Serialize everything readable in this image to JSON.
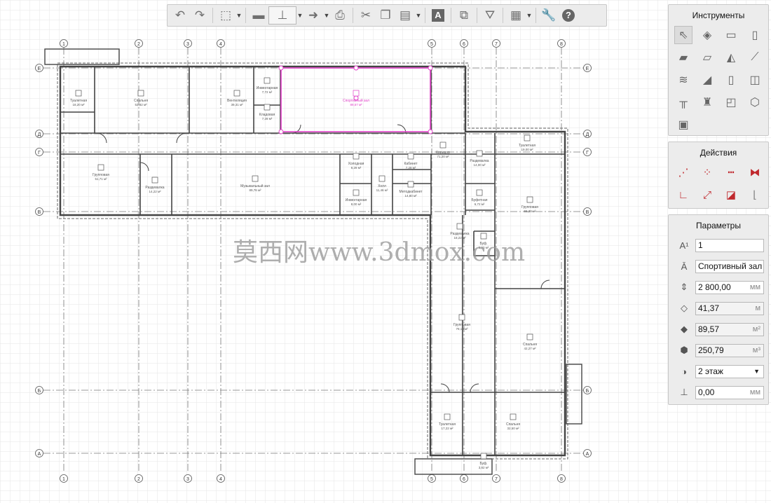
{
  "toolbar": {
    "buttons": [
      {
        "name": "undo-button",
        "icon": "undo-icon",
        "glyph": "↶"
      },
      {
        "name": "redo-button",
        "icon": "redo-icon",
        "glyph": "↷"
      },
      {
        "name": "view-3d-button",
        "icon": "cube-icon",
        "glyph": "⬚"
      },
      {
        "name": "open-button",
        "icon": "folder-icon",
        "glyph": "▬"
      },
      {
        "name": "import-button",
        "icon": "stamp-icon",
        "glyph": "⊥"
      },
      {
        "name": "export-button",
        "icon": "export-icon",
        "glyph": "➜"
      },
      {
        "name": "print-button",
        "icon": "printer-icon",
        "glyph": "⎙"
      },
      {
        "name": "cut-button",
        "icon": "scissors-icon",
        "glyph": "✂"
      },
      {
        "name": "copy-button",
        "icon": "copy-icon",
        "glyph": "❐"
      },
      {
        "name": "paste-button",
        "icon": "paste-icon",
        "glyph": "▤"
      },
      {
        "name": "text-button",
        "icon": "text-icon",
        "glyph": "A"
      },
      {
        "name": "layers-button",
        "icon": "layers-icon",
        "glyph": "⧉"
      },
      {
        "name": "filter-button",
        "icon": "funnel-icon",
        "glyph": "⛛"
      },
      {
        "name": "properties-button",
        "icon": "table-icon",
        "glyph": "▦"
      },
      {
        "name": "settings-button",
        "icon": "wrench-icon",
        "glyph": "🔧"
      },
      {
        "name": "help-button",
        "icon": "help-icon",
        "glyph": "?"
      }
    ]
  },
  "instruments": {
    "title": "Инструменты",
    "tools": [
      {
        "name": "select-tool",
        "icon": "cursor-icon",
        "glyph": "⇖"
      },
      {
        "name": "object-tool",
        "icon": "objects-icon",
        "glyph": "◈"
      },
      {
        "name": "wall-tool",
        "icon": "wall-icon",
        "glyph": "▭"
      },
      {
        "name": "column-tool",
        "icon": "column-icon",
        "glyph": "▯"
      },
      {
        "name": "slab-tool",
        "icon": "slab-icon",
        "glyph": "▰"
      },
      {
        "name": "floor-tool",
        "icon": "floor-icon",
        "glyph": "▱"
      },
      {
        "name": "roof-tool",
        "icon": "roof-icon",
        "glyph": "◭"
      },
      {
        "name": "beam-tool",
        "icon": "beam-icon",
        "glyph": "⟋"
      },
      {
        "name": "stairs-tool",
        "icon": "stairs-icon",
        "glyph": "≋"
      },
      {
        "name": "ramp-tool",
        "icon": "ramp-icon",
        "glyph": "◢"
      },
      {
        "name": "door-tool",
        "icon": "door-icon",
        "glyph": "▯"
      },
      {
        "name": "window-tool",
        "icon": "window-icon",
        "glyph": "◫"
      },
      {
        "name": "railing-tool",
        "icon": "railing-icon",
        "glyph": "╥"
      },
      {
        "name": "furniture-tool",
        "icon": "furniture-icon",
        "glyph": "♜"
      },
      {
        "name": "profile-tool",
        "icon": "profile-icon",
        "glyph": "◰"
      },
      {
        "name": "shell-tool",
        "icon": "shell-icon",
        "glyph": "⬡"
      },
      {
        "name": "room-tool",
        "icon": "room-icon",
        "glyph": "▣"
      }
    ]
  },
  "actions": {
    "title": "Действия",
    "items": [
      {
        "name": "move-action",
        "icon": "move-icon",
        "glyph": "⋰",
        "color": "#c0282d"
      },
      {
        "name": "rotate-action",
        "icon": "rotate-icon",
        "glyph": "⁘",
        "color": "#c0282d"
      },
      {
        "name": "copy-action",
        "icon": "copy-linear-icon",
        "glyph": "┅",
        "color": "#c0282d"
      },
      {
        "name": "mirror-action",
        "icon": "mirror-icon",
        "glyph": "⧓",
        "color": "#c0282d"
      },
      {
        "name": "corner-action",
        "icon": "corner-icon",
        "glyph": "∟",
        "color": "#c0282d"
      },
      {
        "name": "stretch-action",
        "icon": "stretch-icon",
        "glyph": "⤢",
        "color": "#c0282d"
      },
      {
        "name": "offset-action",
        "icon": "offset-icon",
        "glyph": "◪",
        "color": "#c0282d"
      },
      {
        "name": "trim-action",
        "icon": "trim-icon",
        "glyph": "⌊",
        "color": "#888888"
      }
    ]
  },
  "parameters": {
    "title": "Параметры",
    "number": "1",
    "room_name": "Спортивный зал",
    "height": "2 800,00",
    "height_unit": "мм",
    "perimeter": "41,37",
    "perimeter_unit": "м",
    "area": "89,57",
    "area_unit": "м²",
    "volume": "250,79",
    "volume_unit": "м³",
    "floor": "2 этаж",
    "offset": "0,00",
    "offset_unit": "мм"
  },
  "plan": {
    "axes_vertical": [
      "1",
      "2",
      "3",
      "4",
      "5",
      "6",
      "7",
      "8"
    ],
    "axes_horizontal": [
      "Е",
      "Д",
      "Г",
      "В",
      "Б",
      "А"
    ],
    "rooms": [
      {
        "id": "r1",
        "label": "Туалетная",
        "area": "18,20 м²"
      },
      {
        "id": "r2",
        "label": "Спальня",
        "area": "53,82 м²"
      },
      {
        "id": "r3",
        "label": "Инвентарная",
        "area": "7,72 м²"
      },
      {
        "id": "r4",
        "label": "Вентиляция",
        "area": "39,31 м²"
      },
      {
        "id": "r5",
        "label": "Спортивный зал",
        "area": "89,57 м²"
      },
      {
        "id": "r6",
        "label": "Кладовая",
        "area": "7,28 м²"
      },
      {
        "id": "r7",
        "label": "Групповая",
        "area": "51,71 м²"
      },
      {
        "id": "r8",
        "label": "Раздевалка",
        "area": "14,22 м²"
      },
      {
        "id": "r9",
        "label": "Музыкальный зал",
        "area": "89,76 м²"
      },
      {
        "id": "r10",
        "label": "Холодная",
        "area": "8,28 м²"
      },
      {
        "id": "r11",
        "label": "Инвентарная",
        "area": "8,00 м²"
      },
      {
        "id": "r12",
        "label": "Холл",
        "area": "11,46 м²"
      },
      {
        "id": "r13",
        "label": "Кабинет",
        "area": "7,28 м²"
      },
      {
        "id": "r14",
        "label": "Методкабинет",
        "area": "14,80 м²"
      },
      {
        "id": "r15",
        "label": "Коридор",
        "area": "71,20 м²"
      },
      {
        "id": "r16",
        "label": "Раздевалка",
        "area": "14,00 м²"
      },
      {
        "id": "r17",
        "label": "Туалетная",
        "area": "19,00 м²"
      },
      {
        "id": "r18",
        "label": "Буфетная",
        "area": "6,72 м²"
      },
      {
        "id": "r19",
        "label": "Групповая",
        "area": "55,38 м²"
      },
      {
        "id": "r20",
        "label": "Раздевалка",
        "area": "18,22 м²"
      },
      {
        "id": "r21",
        "label": "Буф.",
        "area": "5,00 м²"
      },
      {
        "id": "r22",
        "label": "Групповая",
        "area": "78,18 м²"
      },
      {
        "id": "r23",
        "label": "Спальня",
        "area": "42,27 м²"
      },
      {
        "id": "r24",
        "label": "Туалетная",
        "area": "17,22 м²"
      },
      {
        "id": "r25",
        "label": "Спальня",
        "area": "32,50 м²"
      },
      {
        "id": "r26",
        "label": "Буф.",
        "area": "3,82 м²"
      }
    ]
  },
  "watermark": "莫西网www.3dmox.com",
  "colors": {
    "selection": "#e040c8",
    "grid": "#e6e6e6",
    "wall": "#444444",
    "axis": "#777777",
    "panel_bg": "#ececec",
    "action_red": "#c0282d"
  }
}
